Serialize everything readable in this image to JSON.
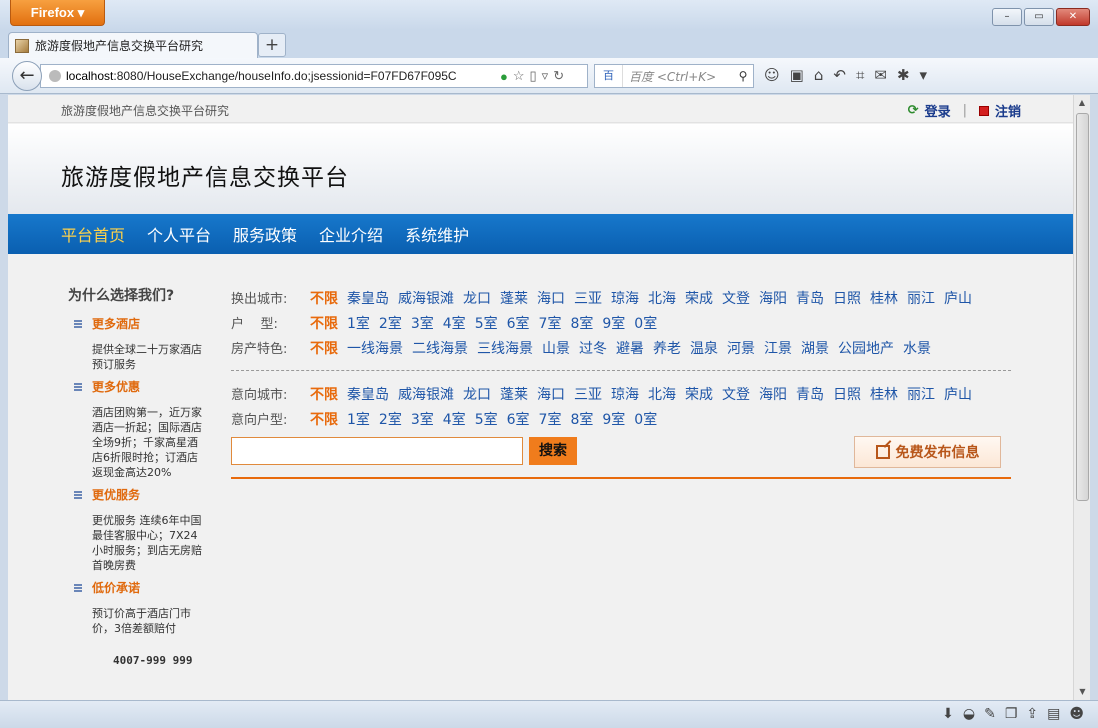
{
  "browser": {
    "app_button": "Firefox",
    "tab_title": "旅游度假地产信息交换平台研究",
    "new_tab": "+",
    "url_host": "localhost",
    "url_rest": ":8080/HouseExchange/houseInfo.do;jsessionid=F07FD67F095C",
    "search_placeholder": "百度 <Ctrl+K>",
    "search_engine": "百",
    "window_controls": {
      "minimize": "–",
      "maximize": "▭",
      "close": "✕"
    }
  },
  "site": {
    "small_name": "旅游度假地产信息交换平台研究",
    "login": "登录",
    "logout": "注销",
    "separator": "|",
    "title": "旅游度假地产信息交换平台"
  },
  "nav": {
    "items": [
      "平台首页",
      "个人平台",
      "服务政策",
      "企业介绍",
      "系统维护"
    ],
    "active_index": 0
  },
  "sidebar": {
    "heading": "为什么选择我们?",
    "reasons": [
      {
        "title": "更多酒店",
        "body": "提供全球二十万家酒店预订服务"
      },
      {
        "title": "更多优惠",
        "body": "酒店团购第一，近万家酒店一折起；国际酒店全场9折；千家高星酒店6折限时抢；订酒店返现金高达20%"
      },
      {
        "title": "更优服务",
        "body": "更优服务 连续6年中国最佳客服中心；7X24小时服务；到店无房赔首晚房费"
      },
      {
        "title": "低价承诺",
        "body": "预订价高于酒店门市价，3倍差额赔付"
      }
    ],
    "hotline": "4007-999 999"
  },
  "filters": {
    "out_city_label": "换出城市:",
    "out_city_options": [
      "不限",
      "秦皇岛",
      "威海银滩",
      "龙口",
      "蓬莱",
      "海口",
      "三亚",
      "琼海",
      "北海",
      "荣成",
      "文登",
      "海阳",
      "青岛",
      "日照",
      "桂林",
      "丽江",
      "庐山"
    ],
    "room_label": "户    型:",
    "room_options": [
      "不限",
      "1室",
      "2室",
      "3室",
      "4室",
      "5室",
      "6室",
      "7室",
      "8室",
      "9室",
      "0室"
    ],
    "feature_label": "房产特色:",
    "feature_options": [
      "不限",
      "一线海景",
      "二线海景",
      "三线海景",
      "山景",
      "过冬",
      "避暑",
      "养老",
      "温泉",
      "河景",
      "江景",
      "湖景",
      "公园地产",
      "水景"
    ],
    "want_city_label": "意向城市:",
    "want_city_options": [
      "不限",
      "秦皇岛",
      "威海银滩",
      "龙口",
      "蓬莱",
      "海口",
      "三亚",
      "琼海",
      "北海",
      "荣成",
      "文登",
      "海阳",
      "青岛",
      "日照",
      "桂林",
      "丽江",
      "庐山"
    ],
    "want_room_label": "意向户型:",
    "want_room_options": [
      "不限",
      "1室",
      "2室",
      "3室",
      "4室",
      "5室",
      "6室",
      "7室",
      "8室",
      "9室",
      "0室"
    ],
    "search_value": "",
    "search_button": "搜索",
    "publish_button": "免费发布信息"
  },
  "colors": {
    "accent": "#e86a0c",
    "nav_blue": "#0a5fb0",
    "link": "#1f56a8"
  }
}
